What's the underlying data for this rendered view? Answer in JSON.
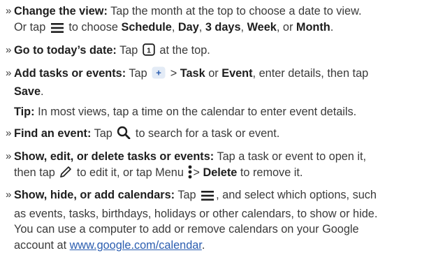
{
  "items": [
    {
      "title": "Change the view:",
      "t1": "Tap the month at the top to choose a date to view.",
      "t2": "Or tap",
      "t3": "to choose",
      "opt1": "Schedule",
      "comma1": ",",
      "opt2": "Day",
      "comma2": ",",
      "opt3": "3 days",
      "comma3": ",",
      "opt4": "Week",
      "t4": ", or",
      "opt5": "Month",
      "t5": "."
    },
    {
      "title": "Go to today’s date:",
      "t1": "Tap",
      "icon_text": "1",
      "t2": "at the top."
    },
    {
      "title": "Add tasks or events:",
      "t1": "Tap",
      "icon_text": "+",
      "t2": ">",
      "opt1": "Task",
      "t3": "or",
      "opt2": "Event",
      "t4": ", enter details, then tap",
      "opt3": "Save",
      "t5": "."
    },
    {
      "title": "Find an event:",
      "t1": "Tap",
      "t2": "to search for a task or event."
    },
    {
      "title": "Show, edit, or delete tasks or events:",
      "t1": "Tap a task or event to open it,",
      "t2": "then tap",
      "t3": "to edit it, or tap Menu",
      "t4": ">",
      "opt1": "Delete",
      "t5": "to remove it."
    },
    {
      "title": "Show, hide, or add calendars:",
      "t1": "Tap",
      "t2": ", and select which options, such",
      "t3": "as events, tasks, birthdays, holidays or other calendars, to show or hide.",
      "t4": "You can use a computer to add or remove calendars on your Google",
      "t5": "account at",
      "link": "www.google.com/calendar",
      "t6": "."
    }
  ],
  "tip": {
    "label": "Tip:",
    "text": "In most views, tap a time on the calendar to enter event details."
  },
  "bullet": "»",
  "icons": {
    "menu": "hamburger-menu-icon",
    "today": "calendar-today-icon",
    "add": "add-plus-icon",
    "search": "search-icon",
    "edit": "pencil-icon",
    "more": "vertical-dots-icon"
  },
  "colors": {
    "text": "#3a3a3a",
    "bold": "#1e1e1e",
    "link": "#2a5db0",
    "add_button_bg": "#e3ebf6"
  }
}
